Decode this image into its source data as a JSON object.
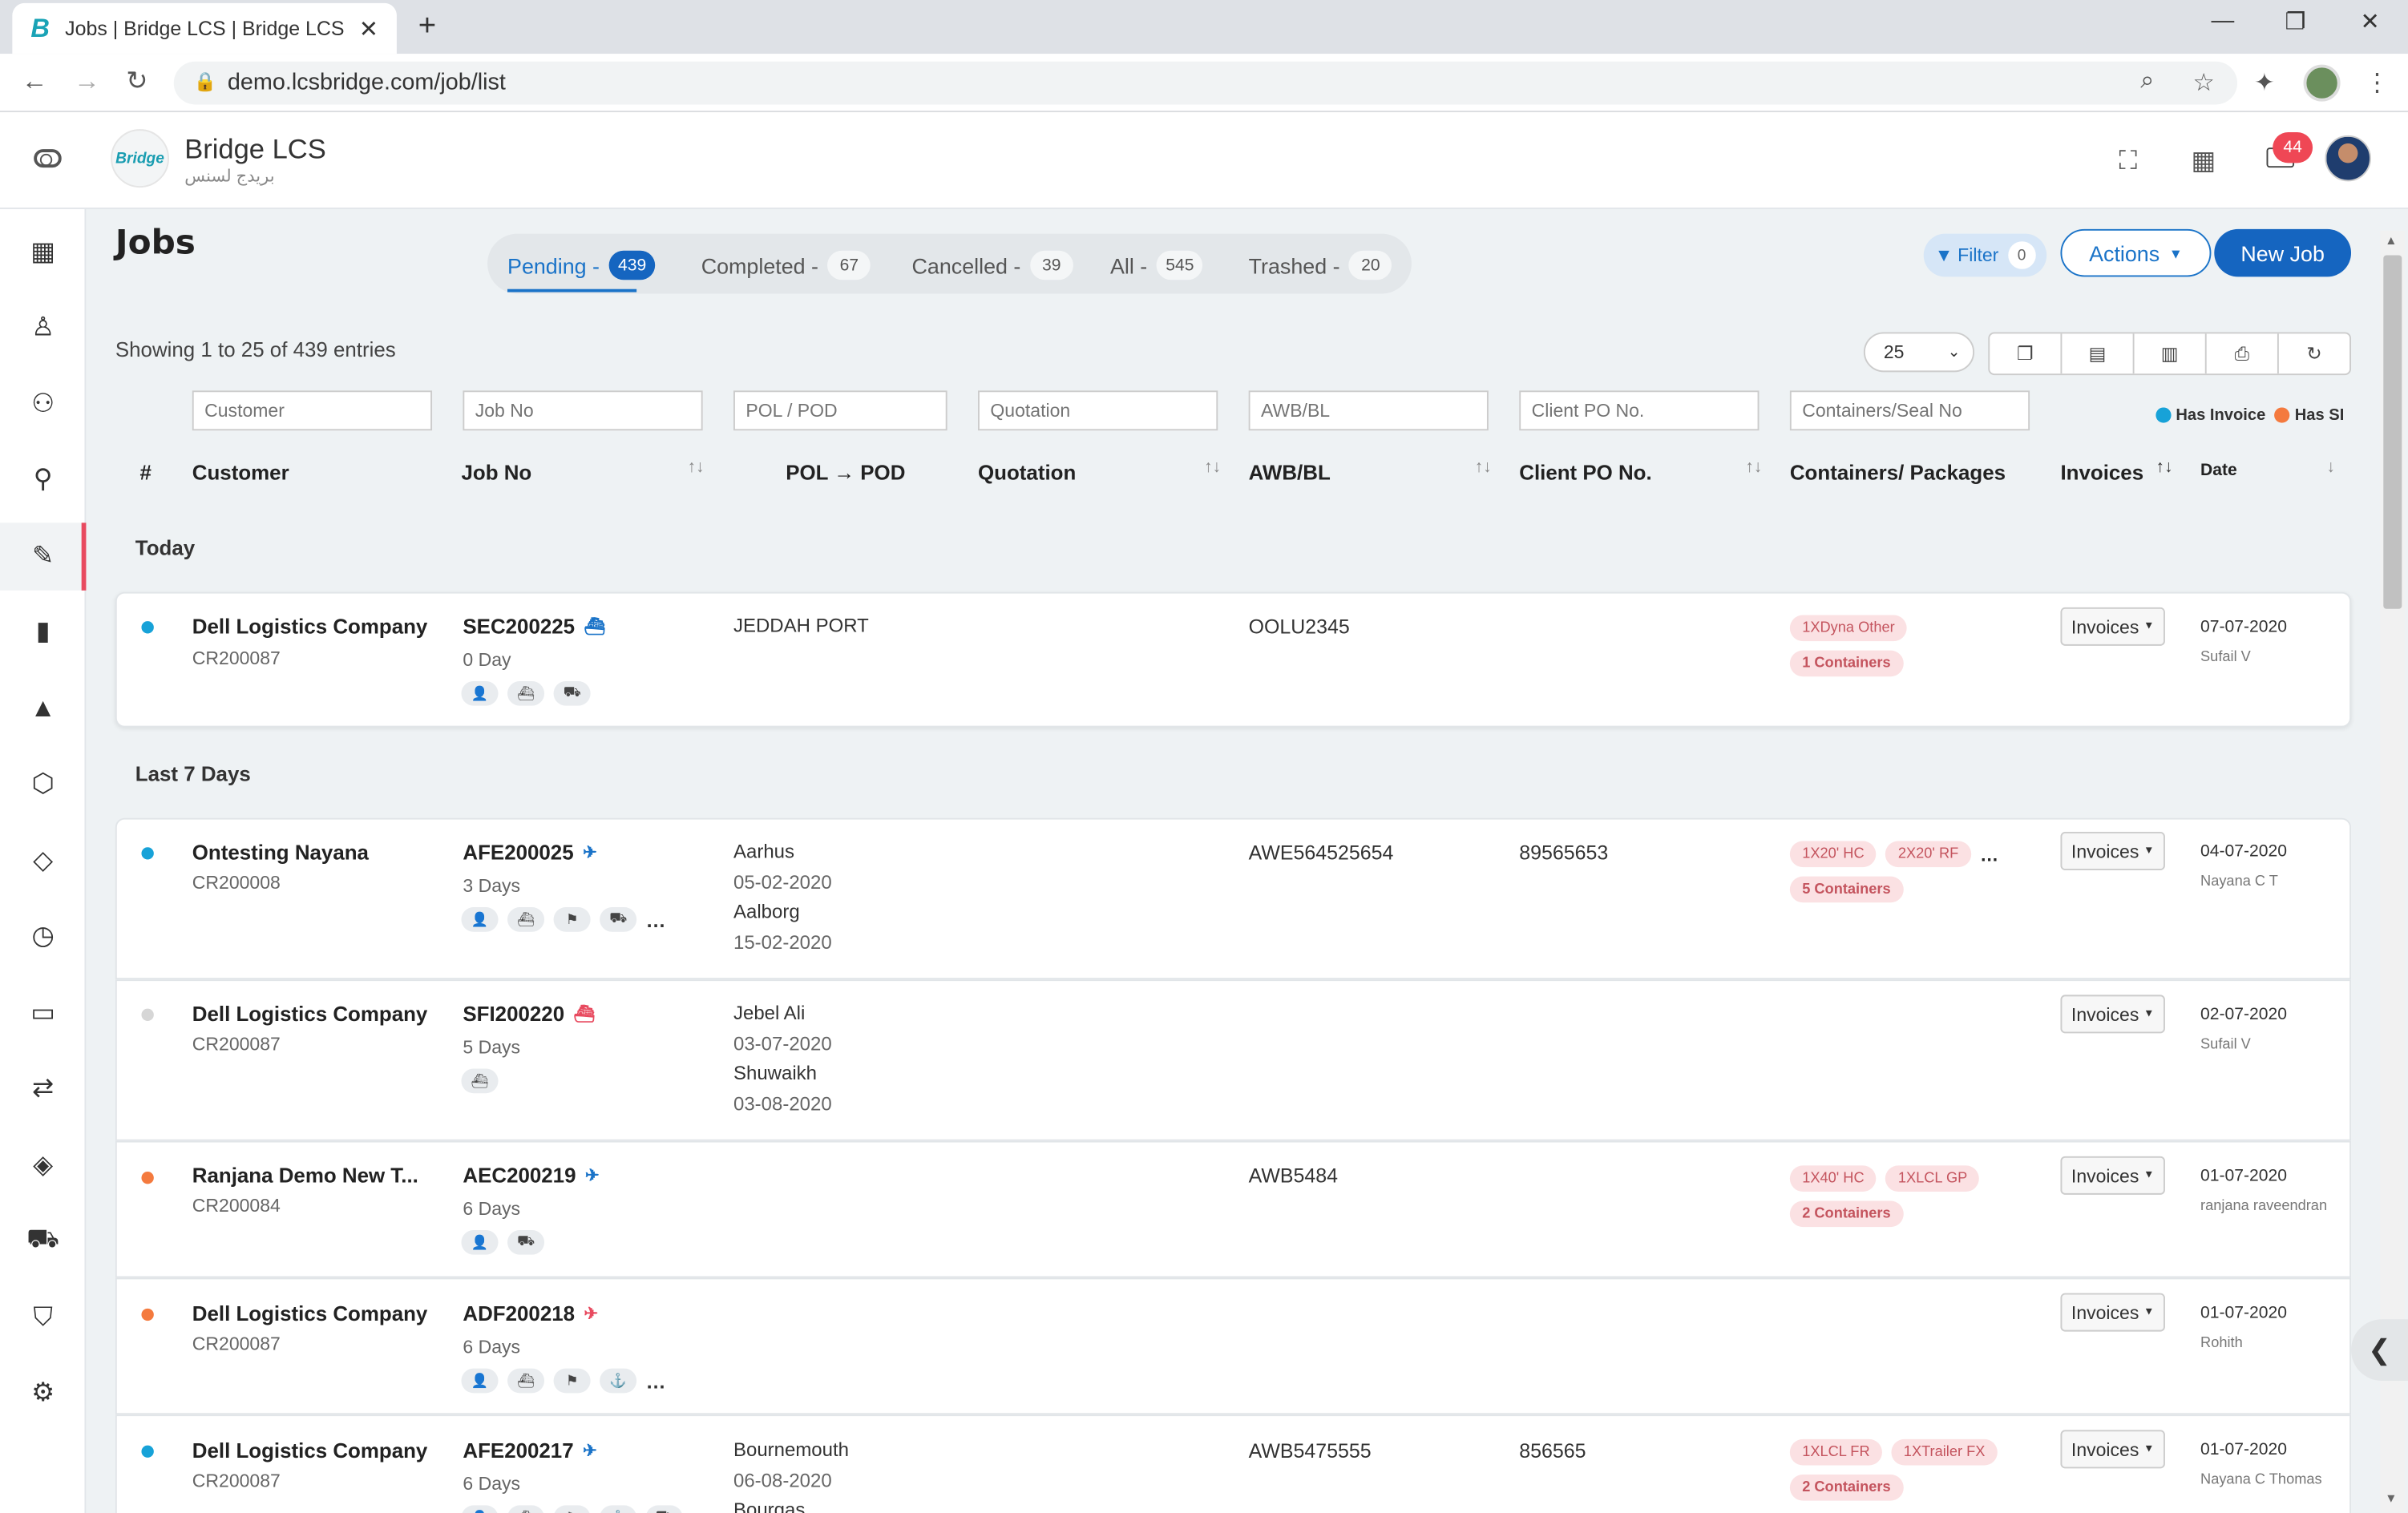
{
  "browser": {
    "tab_title": "Jobs | Bridge LCS | Bridge LCS",
    "url": "demo.lcsbridge.com/job/list"
  },
  "header": {
    "brand": "Bridge LCS",
    "brand_arabic": "بريدج لسنس",
    "logo_text": "Bridge",
    "notifications": "44"
  },
  "page": {
    "title": "Jobs",
    "showing": "Showing 1 to 25 of 439 entries",
    "page_size": "25"
  },
  "status_tabs": [
    {
      "label": "Pending -",
      "count": "439"
    },
    {
      "label": "Completed -",
      "count": "67"
    },
    {
      "label": "Cancelled -",
      "count": "39"
    },
    {
      "label": "All -",
      "count": "545"
    },
    {
      "label": "Trashed -",
      "count": "20"
    }
  ],
  "actions": {
    "filter": "Filter",
    "filter_count": "0",
    "actions": "Actions",
    "new_job": "New Job"
  },
  "filters": {
    "customer": "Customer",
    "job_no": "Job No",
    "pol_pod": "POL / POD",
    "quotation": "Quotation",
    "awb": "AWB/BL",
    "client_po": "Client PO No.",
    "containers": "Containers/Seal No"
  },
  "legend": {
    "has_invoice": "Has Invoice",
    "has_si": "Has SI",
    "invoice_color": "#17a2d8",
    "si_color": "#f47a3e"
  },
  "columns": {
    "num": "#",
    "customer": "Customer",
    "job_no": "Job No",
    "pol_pod": "POL → POD",
    "quotation": "Quotation",
    "awb": "AWB/BL",
    "client_po": "Client PO No.",
    "containers": "Containers/ Packages",
    "invoices": "Invoices",
    "date": "Date"
  },
  "groups": {
    "today": "Today",
    "last7": "Last 7 Days"
  },
  "rows": [
    {
      "customer": "Dell Logistics Company",
      "code": "CR200087",
      "job_no": "SEC200225",
      "age": "0 Day",
      "pol": "JEDDAH PORT",
      "pol_date": "",
      "pod": "",
      "pod_date": "",
      "awb": "OOLU2345",
      "client_po": "",
      "chips": [
        "1XDyna Other",
        "1 Containers"
      ],
      "invoice": "Invoices",
      "date": "07-07-2020",
      "by": "Sufail V"
    },
    {
      "customer": "Ontesting Nayana",
      "code": "CR200008",
      "job_no": "AFE200025",
      "age": "3 Days",
      "pol": "Aarhus",
      "pol_date": "05-02-2020",
      "pod": "Aalborg",
      "pod_date": "15-02-2020",
      "awb": "AWE564525654",
      "client_po": "89565653",
      "chips": [
        "1X20' HC",
        "2X20' RF",
        "5 Containers"
      ],
      "invoice": "Invoices",
      "date": "04-07-2020",
      "by": "Nayana C T"
    },
    {
      "customer": "Dell Logistics Company",
      "code": "CR200087",
      "job_no": "SFI200220",
      "age": "5 Days",
      "pol": "Jebel Ali",
      "pol_date": "03-07-2020",
      "pod": "Shuwaikh",
      "pod_date": "03-08-2020",
      "awb": "",
      "client_po": "",
      "chips": [],
      "invoice": "Invoices",
      "date": "02-07-2020",
      "by": "Sufail V"
    },
    {
      "customer": "Ranjana Demo New T...",
      "code": "CR200084",
      "job_no": "AEC200219",
      "age": "6 Days",
      "pol": "",
      "pol_date": "",
      "pod": "",
      "pod_date": "",
      "awb": "AWB5484",
      "client_po": "",
      "chips": [
        "1X40' HC",
        "1XLCL GP",
        "2 Containers"
      ],
      "invoice": "Invoices",
      "date": "01-07-2020",
      "by": "ranjana raveendran"
    },
    {
      "customer": "Dell Logistics Company",
      "code": "CR200087",
      "job_no": "ADF200218",
      "age": "6 Days",
      "pol": "",
      "pol_date": "",
      "pod": "",
      "pod_date": "",
      "awb": "",
      "client_po": "",
      "chips": [],
      "invoice": "Invoices",
      "date": "01-07-2020",
      "by": "Rohith"
    },
    {
      "customer": "Dell Logistics Company",
      "code": "CR200087",
      "job_no": "AFE200217",
      "age": "6 Days",
      "pol": "Bournemouth",
      "pol_date": "06-08-2020",
      "pod": "Bourgas",
      "pod_date": "",
      "awb": "AWB5475555",
      "client_po": "856565",
      "chips": [
        "1XLCL FR",
        "1XTrailer FX",
        "2 Containers"
      ],
      "invoice": "Invoices",
      "date": "01-07-2020",
      "by": "Nayana C Thomas"
    }
  ]
}
